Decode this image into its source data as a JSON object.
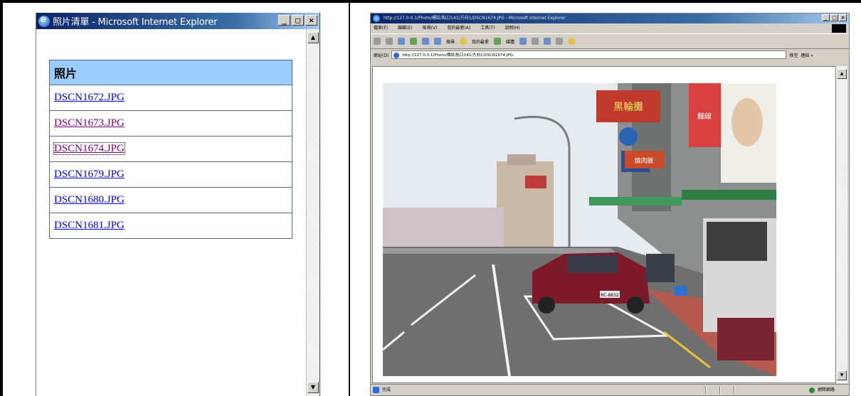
{
  "left_window": {
    "title": "照片清單 - Microsoft Internet Explorer",
    "buttons": {
      "minimize": "_",
      "maximize": "□",
      "close": "×"
    },
    "table": {
      "header": "照片",
      "rows": [
        {
          "label": "DSCN1672.JPG",
          "state": "link"
        },
        {
          "label": "DSCN1673.JPG",
          "state": "visited"
        },
        {
          "label": "DSCN1674.JPG",
          "state": "focused"
        },
        {
          "label": "DSCN1679.JPG",
          "state": "link"
        },
        {
          "label": "DSCN1680.JPG",
          "state": "link"
        },
        {
          "label": "DSCN1681.JPG",
          "state": "link"
        }
      ]
    },
    "scroll": {
      "up": "▲",
      "down": "▼"
    }
  },
  "right_window": {
    "title": "http://127.0.0.1/Photo/標誌/點口141/方向1/DSCN1674.JPG - Microsoft Internet Explorer",
    "menu": [
      "檔案(F)",
      "編輯(E)",
      "檢視(V)",
      "我的最愛(A)",
      "工具(T)",
      "說明(H)"
    ],
    "toolbar": [
      "上一頁",
      "搜尋",
      "我的最愛",
      "媒體"
    ],
    "address_label": "網址(D)",
    "address": "http://127.0.0.1/Photo/標誌/點口141/方向1/DSCN1674.JPG",
    "go_label": "移至",
    "links_label": "連結 »",
    "status": "完成",
    "zone": "網際網路",
    "scroll": {
      "up": "▲",
      "down": "▼"
    },
    "photo": {
      "signs": [
        "黑輪攤",
        "麵線",
        "燒肉飯"
      ],
      "plate": "RC-8832"
    }
  },
  "colors": {
    "title_start": "#0a246a",
    "title_end": "#a6caf0",
    "table_header_bg": "#99ccff",
    "link": "#0000ee",
    "visited": "#800080"
  }
}
